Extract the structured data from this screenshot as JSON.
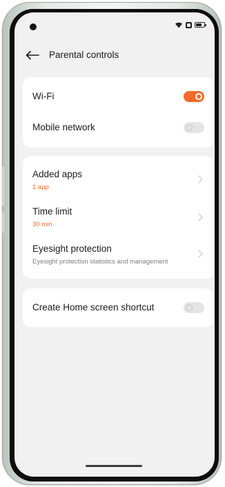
{
  "header": {
    "title": "Parental controls"
  },
  "network": {
    "wifi": {
      "label": "Wi-Fi",
      "on": true
    },
    "mobile": {
      "label": "Mobile network",
      "on": false
    }
  },
  "settings": {
    "added_apps": {
      "label": "Added apps",
      "value": "1 app"
    },
    "time_limit": {
      "label": "Time limit",
      "value": "30 min"
    },
    "eyesight": {
      "label": "Eyesight protection",
      "desc": "Eyesight protection statistics and management"
    }
  },
  "shortcut": {
    "label": "Create Home screen shortcut",
    "on": false
  },
  "colors": {
    "accent": "#f26b2d",
    "background": "#f1f1f1",
    "card": "#ffffff"
  },
  "status_icons": [
    "wifi-icon",
    "sim-icon",
    "battery-icon"
  ]
}
